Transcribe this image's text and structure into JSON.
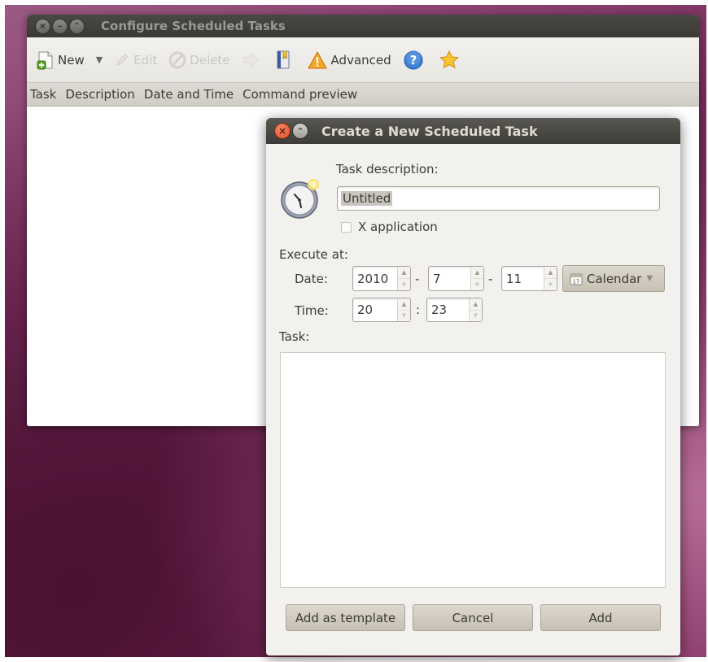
{
  "main_window": {
    "title": "Configure Scheduled Tasks",
    "toolbar": {
      "new_label": "New",
      "edit_label": "Edit",
      "delete_label": "Delete",
      "advanced_label": "Advanced"
    },
    "columns": [
      "Task",
      "Description",
      "Date and Time",
      "Command preview"
    ]
  },
  "dialog": {
    "title": "Create a New Scheduled Task",
    "task_description_label": "Task description:",
    "task_description_value": "Untitled",
    "x_application_label": "X application",
    "execute_at_label": "Execute at:",
    "date_label": "Date:",
    "time_label": "Time:",
    "date": {
      "year": "2010",
      "month": "7",
      "day": "11",
      "sep1": "-",
      "sep2": "-"
    },
    "time": {
      "hour": "20",
      "minute": "23",
      "sep": ":"
    },
    "calendar_label": "Calendar",
    "task_label": "Task:",
    "buttons": {
      "add_template": "Add as template",
      "cancel": "Cancel",
      "add": "Add"
    }
  },
  "colors": {
    "accent_orange": "#df4a22",
    "titlebar_dark": "#3c3b37",
    "wallpaper_purple": "#7a2f5e"
  }
}
